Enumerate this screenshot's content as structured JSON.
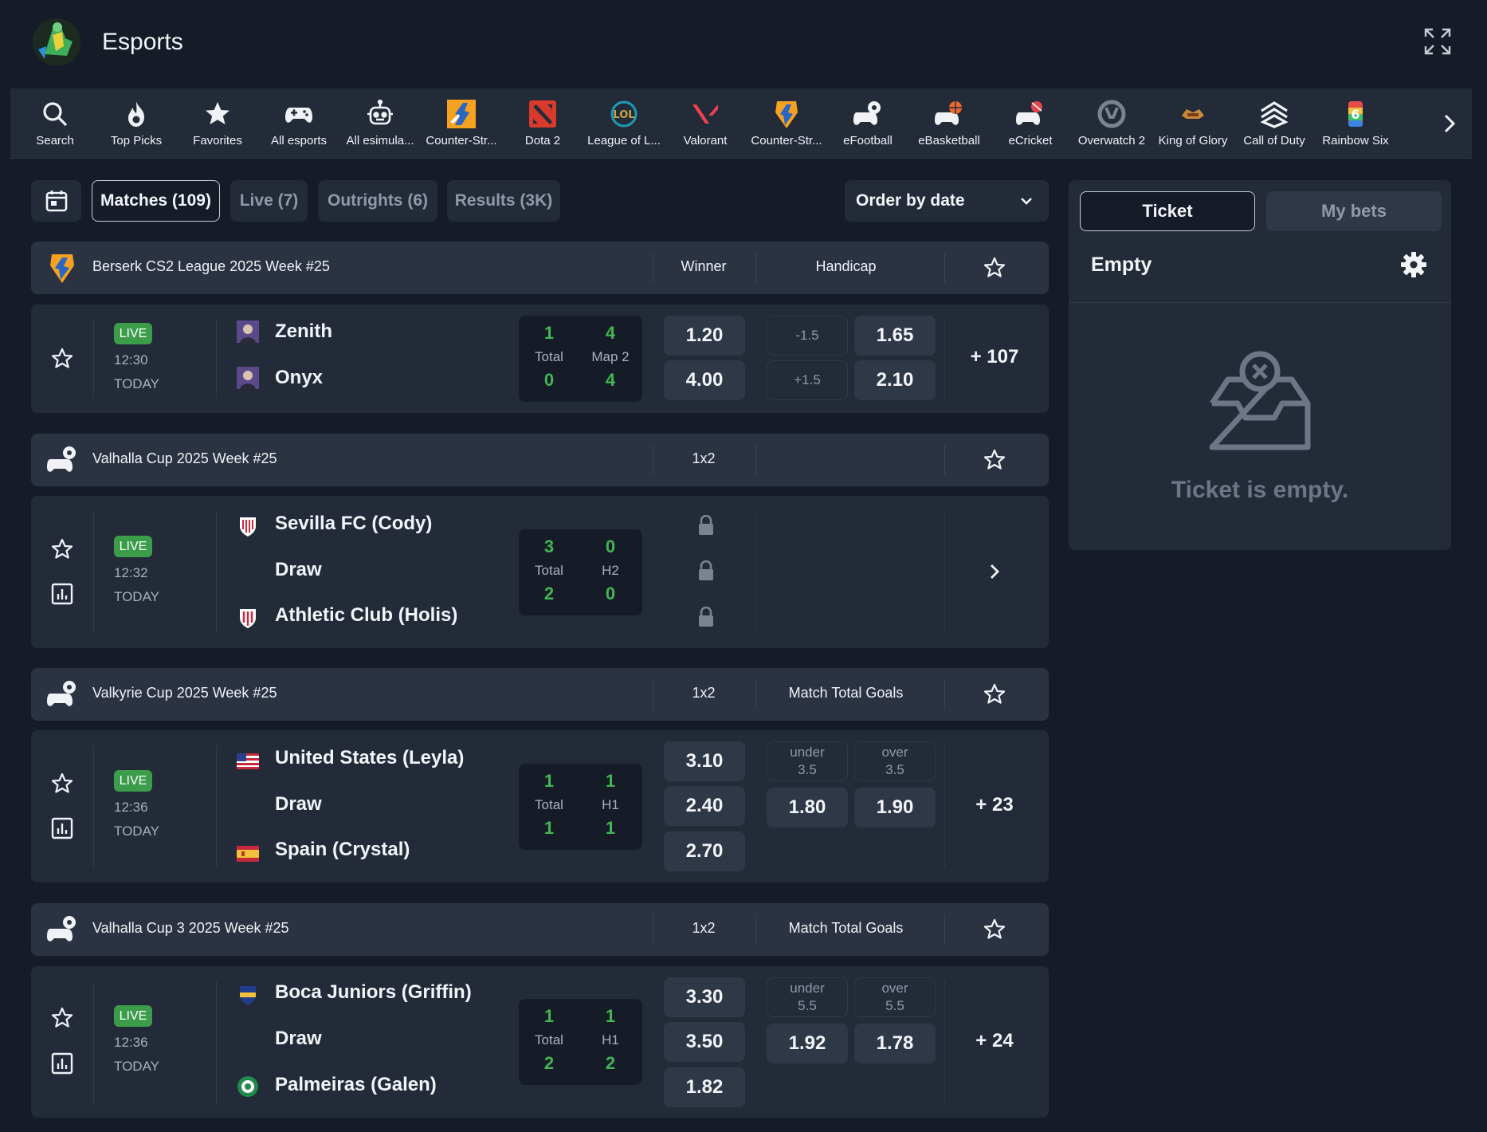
{
  "header": {
    "title": "Esports"
  },
  "categories": [
    {
      "label": "Search",
      "icon": "search-icon"
    },
    {
      "label": "Top Picks",
      "icon": "flame-icon"
    },
    {
      "label": "Favorites",
      "icon": "star-icon"
    },
    {
      "label": "All esports",
      "icon": "gamepad-icon"
    },
    {
      "label": "All esimula...",
      "icon": "robot-icon"
    },
    {
      "label": "Counter-Str...",
      "icon": "counter-strike-icon"
    },
    {
      "label": "Dota 2",
      "icon": "dota2-icon"
    },
    {
      "label": "League of L...",
      "icon": "lol-icon"
    },
    {
      "label": "Valorant",
      "icon": "valorant-icon"
    },
    {
      "label": "Counter-Str...",
      "icon": "counter-strike-2-icon"
    },
    {
      "label": "eFootball",
      "icon": "efootball-icon"
    },
    {
      "label": "eBasketball",
      "icon": "ebasketball-icon"
    },
    {
      "label": "eCricket",
      "icon": "ecricket-icon"
    },
    {
      "label": "Overwatch 2",
      "icon": "overwatch-icon"
    },
    {
      "label": "King of Glory",
      "icon": "king-of-glory-icon"
    },
    {
      "label": "Call of Duty",
      "icon": "call-of-duty-icon"
    },
    {
      "label": "Rainbow Six",
      "icon": "rainbow-six-icon"
    }
  ],
  "filters": {
    "matches": "Matches (109)",
    "live": "Live (7)",
    "outrights": "Outrights (6)",
    "results": "Results (3K)",
    "order": "Order by date"
  },
  "leagues": [
    {
      "name": "Berserk CS2 League 2025 Week #25",
      "col1": "Winner",
      "col2": "Handicap",
      "match": {
        "badge": "LIVE",
        "time": "12:30",
        "day": "TODAY",
        "teams": [
          "Zenith",
          "Onyx"
        ],
        "score": {
          "a1": "1",
          "a2": "4",
          "l1": "Total",
          "l2": "Map 2",
          "b1": "0",
          "b2": "4"
        },
        "odds": [
          "1.20",
          "4.00"
        ],
        "handicap": [
          {
            "line": "-1.5",
            "odd": "1.65"
          },
          {
            "line": "+1.5",
            "odd": "2.10"
          }
        ],
        "more": "+ 107"
      }
    },
    {
      "name": "Valhalla Cup 2025 Week #25",
      "col1": "1x2",
      "col2": "",
      "match": {
        "badge": "LIVE",
        "time": "12:32",
        "day": "TODAY",
        "teams": [
          "Sevilla FC (Cody)",
          "Draw",
          "Athletic Club (Holis)"
        ],
        "score": {
          "a1": "3",
          "a2": "0",
          "l1": "Total",
          "l2": "H2",
          "b1": "2",
          "b2": "0"
        }
      }
    },
    {
      "name": "Valkyrie Cup 2025 Week #25",
      "col1": "1x2",
      "col2": "Match Total Goals",
      "match": {
        "badge": "LIVE",
        "time": "12:36",
        "day": "TODAY",
        "teams": [
          "United States (Leyla)",
          "Draw",
          "Spain (Crystal)"
        ],
        "score": {
          "a1": "1",
          "a2": "1",
          "l1": "Total",
          "l2": "H1",
          "b1": "1",
          "b2": "1"
        },
        "odds": [
          "3.10",
          "2.40",
          "2.70"
        ],
        "goals": {
          "under": "under",
          "under_line": "3.5",
          "over": "over",
          "over_line": "3.5",
          "under_odd": "1.80",
          "over_odd": "1.90"
        },
        "more": "+ 23"
      }
    },
    {
      "name": "Valhalla Cup 3 2025 Week #25",
      "col1": "1x2",
      "col2": "Match Total Goals",
      "match": {
        "badge": "LIVE",
        "time": "12:36",
        "day": "TODAY",
        "teams": [
          "Boca Juniors (Griffin)",
          "Draw",
          "Palmeiras (Galen)"
        ],
        "score": {
          "a1": "1",
          "a2": "1",
          "l1": "Total",
          "l2": "H1",
          "b1": "2",
          "b2": "2"
        },
        "odds": [
          "3.30",
          "3.50",
          "1.82"
        ],
        "goals": {
          "under": "under",
          "under_line": "5.5",
          "over": "over",
          "over_line": "5.5",
          "under_odd": "1.92",
          "over_odd": "1.78"
        },
        "more": "+ 24"
      }
    }
  ],
  "ticket": {
    "tab_ticket": "Ticket",
    "tab_mybets": "My bets",
    "title": "Empty",
    "message": "Ticket is empty."
  },
  "colors": {
    "bg": "#161c27",
    "panel": "#232b39",
    "odd": "#2f3847",
    "live": "#3b9c4a",
    "score": "#43b553"
  }
}
